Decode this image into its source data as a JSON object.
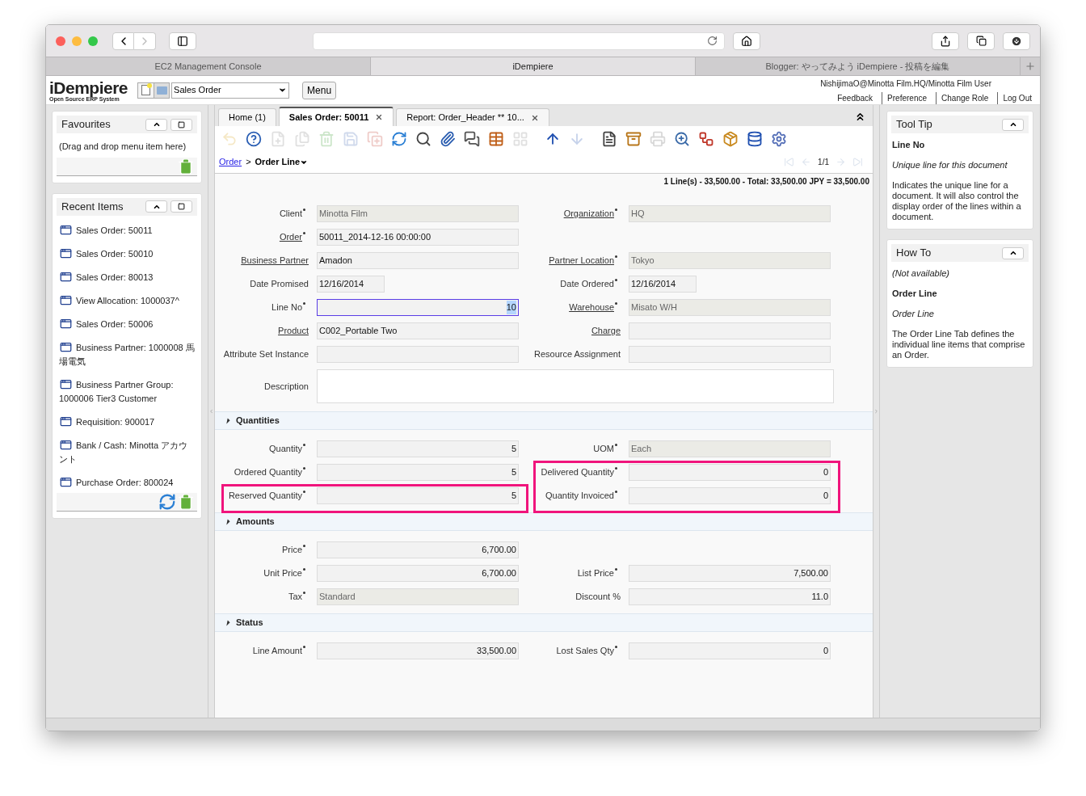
{
  "browser": {
    "tabs": [
      {
        "label": "EC2 Management Console",
        "selected": false
      },
      {
        "label": "iDempiere",
        "selected": true
      },
      {
        "label": "Blogger: やってみよう iDempiere - 投稿を編集",
        "selected": false
      }
    ]
  },
  "header": {
    "logo": "iDempiere",
    "logo_subtitle": "Open Source ERP System",
    "menu_select": "Sales Order",
    "menu_button": "Menu",
    "user": "NishijimaO@Minotta Film.HQ/Minotta Film User",
    "links": [
      "Feedback",
      "Preference",
      "Change Role",
      "Log Out"
    ]
  },
  "favourites": {
    "title": "Favourites",
    "hint": "(Drag and drop menu item here)"
  },
  "recent": {
    "title": "Recent Items",
    "items": [
      "Sales Order: 50011",
      "Sales Order: 50010",
      "Sales Order: 80013",
      "View Allocation: 1000037^",
      "Sales Order: 50006",
      "Business Partner: 1000008 馬場電気",
      "Business Partner Group: 1000006 Tier3 Customer",
      "Requisition: 900017",
      "Bank / Cash: Minotta アカウント",
      "Purchase Order: 800024"
    ]
  },
  "app_tabs": [
    {
      "label": "Home (1)",
      "selected": false,
      "closable": false
    },
    {
      "label": "Sales Order: 50011",
      "selected": true,
      "closable": true
    },
    {
      "label": "Report: Order_Header ** 10...",
      "selected": false,
      "closable": true
    }
  ],
  "toolbar": [
    {
      "kind": "undo",
      "disabled": true
    },
    {
      "kind": "help",
      "disabled": false
    },
    {
      "kind": "new",
      "disabled": true
    },
    {
      "kind": "copy",
      "disabled": true
    },
    {
      "kind": "delete",
      "disabled": true
    },
    {
      "kind": "save",
      "disabled": true
    },
    {
      "kind": "savenew",
      "disabled": true
    },
    {
      "kind": "refresh",
      "disabled": false
    },
    {
      "kind": "find",
      "disabled": false
    },
    {
      "kind": "attach",
      "disabled": false
    },
    {
      "kind": "chat",
      "disabled": false
    },
    {
      "kind": "grid",
      "disabled": false
    },
    {
      "kind": "multi",
      "disabled": true
    },
    {
      "kind": "up",
      "disabled": false
    },
    {
      "kind": "down",
      "disabled": true
    },
    {
      "kind": "report",
      "disabled": false
    },
    {
      "kind": "archive",
      "disabled": false
    },
    {
      "kind": "print",
      "disabled": true
    },
    {
      "kind": "zoom",
      "disabled": false
    },
    {
      "kind": "workflow",
      "disabled": false
    },
    {
      "kind": "product",
      "disabled": false
    },
    {
      "kind": "database",
      "disabled": false
    },
    {
      "kind": "process",
      "disabled": false
    }
  ],
  "breadcrumb": {
    "parent": "Order",
    "separator": ">",
    "current": "Order Line"
  },
  "navigation": {
    "record": "1/1",
    "first_disabled": true,
    "prev_disabled": true,
    "next_disabled": true,
    "last_disabled": true
  },
  "summary": "1 Line(s) - 33,500.00 - Total: 33,500.00 JPY = 33,500.00",
  "sections": [
    {
      "rows": [
        {
          "left": {
            "label": "Client",
            "mandatory": true,
            "link": false,
            "readonly": true,
            "kind": "text",
            "value": "Minotta Film"
          },
          "right": {
            "label": "Organization",
            "mandatory": true,
            "link": true,
            "readonly": true,
            "kind": "text",
            "value": "HQ"
          }
        },
        {
          "left": {
            "label": "Order",
            "mandatory": true,
            "link": true,
            "readonly": false,
            "kind": "text",
            "value": "50011_2014-12-16 00:00:00"
          }
        },
        {
          "left": {
            "label": "Business Partner",
            "mandatory": false,
            "link": true,
            "readonly": false,
            "kind": "text",
            "value": "Amadon"
          },
          "right": {
            "label": "Partner Location",
            "mandatory": true,
            "link": true,
            "readonly": true,
            "kind": "text",
            "value": "Tokyo"
          }
        },
        {
          "left": {
            "label": "Date Promised",
            "mandatory": false,
            "link": false,
            "readonly": false,
            "kind": "date",
            "value": "12/16/2014"
          },
          "right": {
            "label": "Date Ordered",
            "mandatory": true,
            "link": false,
            "readonly": false,
            "kind": "date",
            "value": "12/16/2014"
          }
        },
        {
          "left": {
            "label": "Line No",
            "mandatory": true,
            "link": false,
            "readonly": false,
            "kind": "number",
            "value": "10",
            "focused": true
          },
          "right": {
            "label": "Warehouse",
            "mandatory": true,
            "link": true,
            "readonly": true,
            "kind": "text",
            "value": "Misato W/H"
          }
        },
        {
          "left": {
            "label": "Product",
            "mandatory": false,
            "link": true,
            "readonly": false,
            "kind": "text",
            "value": "C002_Portable Two"
          },
          "right": {
            "label": "Charge",
            "mandatory": false,
            "link": true,
            "readonly": false,
            "kind": "text"
          }
        },
        {
          "left": {
            "label": "Attribute Set Instance",
            "mandatory": false,
            "link": false,
            "readonly": false,
            "kind": "text"
          },
          "right": {
            "label": "Resource Assignment",
            "mandatory": false,
            "link": false,
            "readonly": false,
            "kind": "text"
          }
        },
        {
          "wide": {
            "label": "Description",
            "mandatory": false,
            "link": false,
            "readonly": false,
            "kind": "textarea"
          }
        }
      ]
    },
    {
      "title": "Quantities",
      "expanded": true,
      "rows": [
        {
          "left": {
            "label": "Quantity",
            "mandatory": true,
            "link": false,
            "readonly": false,
            "kind": "number",
            "value": "5"
          },
          "right": {
            "label": "UOM",
            "mandatory": true,
            "link": false,
            "readonly": true,
            "kind": "text",
            "value": "Each"
          }
        },
        {
          "left": {
            "label": "Ordered Quantity",
            "mandatory": true,
            "link": false,
            "readonly": false,
            "kind": "number",
            "value": "5"
          },
          "right": {
            "label": "Delivered Quantity",
            "mandatory": true,
            "link": false,
            "readonly": false,
            "kind": "number",
            "value": "0",
            "highlighted": true
          }
        },
        {
          "left": {
            "label": "Reserved Quantity",
            "mandatory": true,
            "link": false,
            "readonly": false,
            "kind": "number",
            "value": "5",
            "highlighted": true
          },
          "right": {
            "label": "Quantity Invoiced",
            "mandatory": true,
            "link": false,
            "readonly": false,
            "kind": "number",
            "value": "0",
            "highlighted": true
          }
        }
      ]
    },
    {
      "title": "Amounts",
      "expanded": true,
      "rows": [
        {
          "left": {
            "label": "Price",
            "mandatory": true,
            "link": false,
            "readonly": false,
            "kind": "number",
            "value": "6,700.00"
          }
        },
        {
          "left": {
            "label": "Unit Price",
            "mandatory": true,
            "link": false,
            "readonly": false,
            "kind": "number",
            "value": "6,700.00"
          },
          "right": {
            "label": "List Price",
            "mandatory": true,
            "link": false,
            "readonly": false,
            "kind": "number",
            "value": "7,500.00"
          }
        },
        {
          "left": {
            "label": "Tax",
            "mandatory": true,
            "link": false,
            "readonly": true,
            "kind": "text",
            "value": "Standard"
          },
          "right": {
            "label": "Discount %",
            "mandatory": false,
            "link": false,
            "readonly": false,
            "kind": "number",
            "value": "11.0"
          }
        }
      ]
    },
    {
      "title": "Status",
      "expanded": true,
      "rows": [
        {
          "left": {
            "label": "Line Amount",
            "mandatory": true,
            "link": false,
            "readonly": false,
            "kind": "number",
            "value": "33,500.00"
          },
          "right": {
            "label": "Lost Sales Qty",
            "mandatory": true,
            "link": false,
            "readonly": false,
            "kind": "number",
            "value": "0"
          }
        }
      ]
    }
  ],
  "tooltip": {
    "title": "Tool Tip",
    "blocks": [
      {
        "kind": "heading",
        "text": "Line No"
      },
      {
        "kind": "italic",
        "text": "Unique line for this document"
      },
      {
        "kind": "text",
        "text": "Indicates the unique line for a document. It will also control the display order of the lines within a document."
      }
    ]
  },
  "howto": {
    "title": "How To",
    "blocks": [
      {
        "kind": "italic",
        "text": "(Not available)"
      },
      {
        "kind": "heading",
        "text": "Order Line"
      },
      {
        "kind": "italic",
        "text": "Order Line"
      },
      {
        "kind": "text",
        "text": "The Order Line Tab defines the individual line items that comprise an Order."
      }
    ]
  }
}
